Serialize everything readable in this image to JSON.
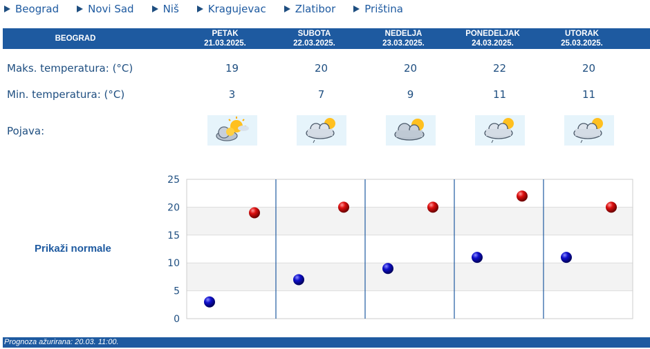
{
  "nav": [
    {
      "label": "Beograd"
    },
    {
      "label": "Novi Sad"
    },
    {
      "label": "Niš"
    },
    {
      "label": "Kragujevac"
    },
    {
      "label": "Zlatibor"
    },
    {
      "label": "Priština"
    }
  ],
  "table": {
    "city": "BEOGRAD",
    "days": [
      {
        "name": "PETAK",
        "date": "21.03.2025.",
        "max": "19",
        "min": "3",
        "icon": "sun-cloud-icon"
      },
      {
        "name": "SUBOTA",
        "date": "22.03.2025.",
        "max": "20",
        "min": "7",
        "icon": "cloud-sun-light-rain-icon"
      },
      {
        "name": "NEDELJA",
        "date": "23.03.2025.",
        "max": "20",
        "min": "9",
        "icon": "cloud-sun-icon"
      },
      {
        "name": "PONEDELJAK",
        "date": "24.03.2025.",
        "max": "22",
        "min": "11",
        "icon": "cloud-sun-light-rain-icon"
      },
      {
        "name": "UTORAK",
        "date": "25.03.2025.",
        "max": "20",
        "min": "11",
        "icon": "cloud-sun-light-rain-icon"
      }
    ],
    "max_label": "Maks. temperatura: (°C)",
    "min_label": "Min. temperatura: (°C)",
    "phenomenon_label": "Pojava:"
  },
  "normals_link": "Prikaži normale",
  "footer": "Prognoza ažurirana:  20.03. 11:00.",
  "colors": {
    "brand": "#1e5aa0",
    "max_marker": "#cc0000",
    "min_marker": "#0000cc"
  },
  "chart_data": {
    "type": "scatter",
    "categories": [
      "PETAK",
      "SUBOTA",
      "NEDELJA",
      "PONEDELJAK",
      "UTORAK"
    ],
    "series": [
      {
        "values": [
          19,
          20,
          20,
          22,
          20
        ]
      },
      {
        "values": [
          3,
          7,
          9,
          11,
          11
        ]
      }
    ],
    "ylim": [
      0,
      25
    ],
    "yticks": [
      "0",
      "5",
      "10",
      "15",
      "20",
      "25"
    ],
    "grid": true
  }
}
